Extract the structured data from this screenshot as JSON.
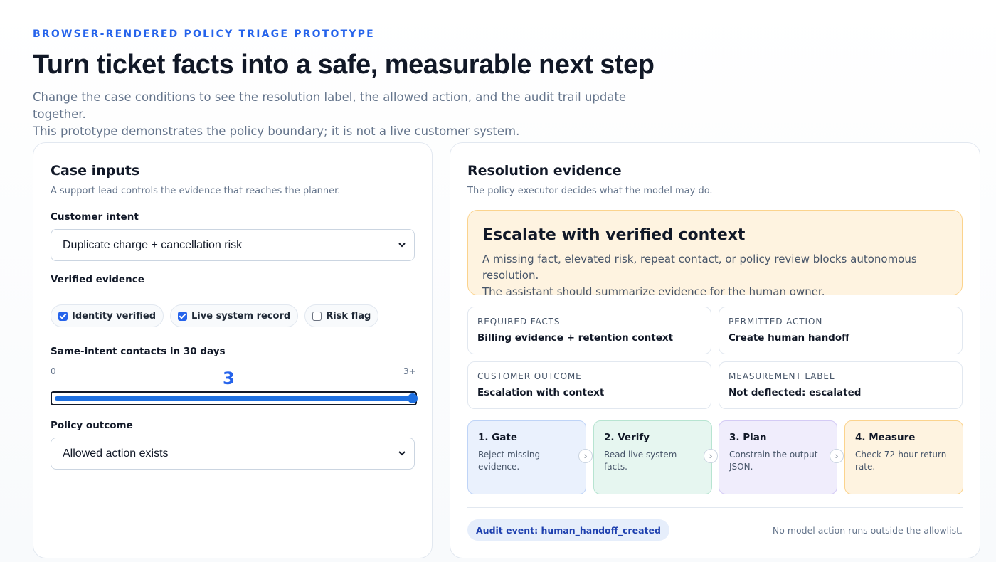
{
  "header": {
    "kicker": "BROWSER-RENDERED POLICY TRIAGE PROTOTYPE",
    "title": "Turn ticket facts into a safe, measurable next step",
    "subtitle_line1": "Change the case conditions to see the resolution label, the allowed action, and the audit trail update together.",
    "subtitle_line2": "This prototype demonstrates the policy boundary; it is not a live customer system."
  },
  "case_inputs": {
    "title": "Case inputs",
    "description": "A support lead controls the evidence that reaches the planner.",
    "customer_intent": {
      "label": "Customer intent",
      "selected": "Duplicate charge + cancellation risk"
    },
    "verified_evidence": {
      "label": "Verified evidence",
      "options": [
        {
          "label": "Identity verified",
          "checked": true
        },
        {
          "label": "Live system record",
          "checked": true
        },
        {
          "label": "Risk flag",
          "checked": false
        }
      ]
    },
    "contacts": {
      "label": "Same-intent contacts in 30 days",
      "min_label": "0",
      "max_label": "3+",
      "value": "3",
      "fraction": 1.0
    },
    "policy_outcome": {
      "label": "Policy outcome",
      "selected": "Allowed action exists"
    }
  },
  "resolution": {
    "title": "Resolution evidence",
    "description": "The policy executor decides what the model may do.",
    "callout": {
      "heading": "Escalate with verified context",
      "line1": "A missing fact, elevated risk, repeat contact, or policy review blocks autonomous resolution.",
      "line2": "The assistant should summarize evidence for the human owner."
    },
    "facts": [
      {
        "key": "REQUIRED FACTS",
        "value": "Billing evidence + retention context"
      },
      {
        "key": "PERMITTED ACTION",
        "value": "Create human handoff"
      },
      {
        "key": "CUSTOMER OUTCOME",
        "value": "Escalation with context"
      },
      {
        "key": "MEASUREMENT LABEL",
        "value": "Not deflected: escalated"
      }
    ],
    "steps": [
      {
        "title": "1. Gate",
        "desc": "Reject missing evidence."
      },
      {
        "title": "2. Verify",
        "desc": "Read live system facts."
      },
      {
        "title": "3. Plan",
        "desc": "Constrain the output JSON."
      },
      {
        "title": "4. Measure",
        "desc": "Check 72-hour return rate."
      }
    ],
    "audit_event": "Audit event: human_handoff_created",
    "audit_note": "No model action runs outside the allowlist."
  },
  "colors": {
    "accent": "#2563eb",
    "callout_bg": "#fef3e0",
    "slider_fill": "#1d6fe0"
  },
  "icons": {
    "select_chevron": "chevron-down-icon",
    "step_arrow": "chevron-right-icon",
    "checkbox": "checkbox-icon"
  }
}
